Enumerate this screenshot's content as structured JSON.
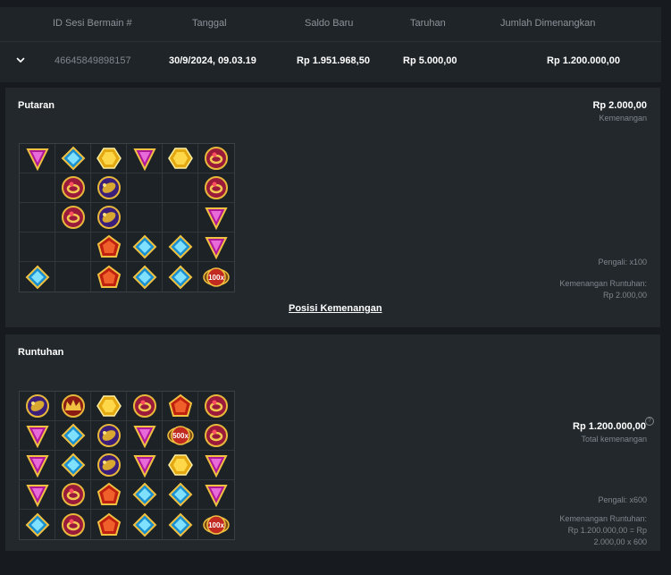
{
  "table": {
    "headers": [
      "ID Sesi Bermain #",
      "Tanggal",
      "Saldo Baru",
      "Taruhan",
      "Jumlah Dimenangkan"
    ],
    "row": {
      "session_id": "46645849898157",
      "date": "30/9/2024, 09.03.19",
      "new_balance": "Rp 1.951.968,50",
      "bet": "Rp 5.000,00",
      "won": "Rp 1.200.000,00"
    }
  },
  "spin": {
    "title": "Putaran",
    "amount": "Rp 2.000,00",
    "amount_label": "Kemenangan",
    "multiplier": "Pengali: x100",
    "cascade_label": "Kemenangan Runtuhan:",
    "cascade_value": "Rp 2.000,00",
    "link": "Posisi Kemenangan",
    "grid": [
      [
        "pink-tri",
        "blue-dia",
        "gold-hex",
        "pink-tri",
        "gold-hex",
        "ring"
      ],
      [
        "",
        "ring",
        "scarab",
        "",
        "",
        "ring"
      ],
      [
        "",
        "ring",
        "scarab",
        "",
        "",
        "pink-tri"
      ],
      [
        "",
        "",
        "red-pent",
        "blue-dia",
        "blue-dia",
        "pink-tri"
      ],
      [
        "blue-dia",
        "",
        "red-pent",
        "blue-dia",
        "blue-dia",
        "mult"
      ]
    ],
    "mult_labels": {
      "4-5": "100x"
    }
  },
  "cascade": {
    "title": "Runtuhan",
    "amount": "Rp 1.200.000,00",
    "amount_label": "Total kemenangan",
    "help": "?",
    "multiplier": "Pengali: x600",
    "cascade_label": "Kemenangan Runtuhan:",
    "cascade_value_1": "Rp 1.200.000,00 = Rp",
    "cascade_value_2": "2.000,00 x 600",
    "grid": [
      [
        "scarab",
        "crown",
        "gold-hex",
        "ring",
        "red-pent",
        "ring"
      ],
      [
        "pink-tri",
        "blue-dia",
        "scarab",
        "pink-tri",
        "mult",
        "ring"
      ],
      [
        "pink-tri",
        "blue-dia",
        "scarab",
        "pink-tri",
        "gold-hex",
        "pink-tri"
      ],
      [
        "pink-tri",
        "ring",
        "red-pent",
        "blue-dia",
        "blue-dia",
        "pink-tri"
      ],
      [
        "blue-dia",
        "ring",
        "red-pent",
        "blue-dia",
        "blue-dia",
        "mult"
      ]
    ],
    "mult_labels": {
      "1-4": "500x",
      "4-5": "100x"
    }
  },
  "icon_names": {
    "pink-tri": "pink-triangle-gem-icon",
    "blue-dia": "blue-diamond-gem-icon",
    "gold-hex": "gold-hexagon-gem-icon",
    "red-pent": "red-pentagon-gem-icon",
    "ring": "ruby-ring-icon",
    "scarab": "gold-scarab-icon",
    "crown": "crown-icon",
    "mult": "multiplier-orb-icon"
  },
  "colors": {
    "background": "#171b1f",
    "panel": "#22282c",
    "header": "#1f2428",
    "muted_text": "#7f868d"
  }
}
